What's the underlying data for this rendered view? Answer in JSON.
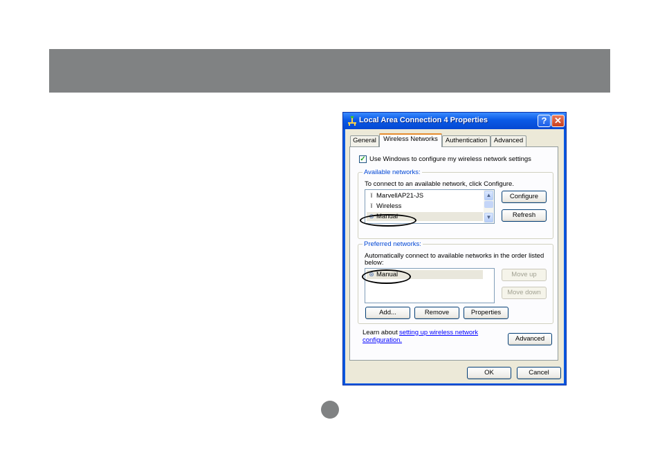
{
  "dialog": {
    "title": "Local Area Connection 4 Properties",
    "help_label": "?",
    "close_label": "✕",
    "tabs": [
      "General",
      "Wireless Networks",
      "Authentication",
      "Advanced"
    ],
    "use_windows_checkbox": {
      "checked": true,
      "label": "Use Windows to configure my wireless network settings"
    },
    "available": {
      "group_title": "Available networks:",
      "instruction": "To connect to an available network, click Configure.",
      "networks": [
        {
          "name": "MarvellAP21-JS",
          "icon": "antenna-icon"
        },
        {
          "name": "Wireless",
          "icon": "antenna-icon"
        },
        {
          "name": "Manual",
          "icon": "wireless-network-icon"
        }
      ],
      "configure_label": "Configure",
      "refresh_label": "Refresh"
    },
    "preferred": {
      "group_title": "Preferred networks:",
      "instruction_line1": "Automatically connect to available networks in the order listed",
      "instruction_line2": "below:",
      "networks": [
        {
          "name": "Manual",
          "icon": "wireless-network-icon"
        }
      ],
      "move_up_label": "Move up",
      "move_down_label": "Move down",
      "add_label": "Add...",
      "remove_label": "Remove",
      "properties_label": "Properties"
    },
    "learn_prefix": "Learn about ",
    "learn_link_part1": "setting up wireless network",
    "learn_link_part2": "configuration.",
    "advanced_label": "Advanced",
    "ok_label": "OK",
    "cancel_label": "Cancel"
  },
  "colors": {
    "title_bar": "#0b5ae6",
    "header_band": "#808283",
    "link": "#0000ff",
    "group_title": "#0046d5"
  }
}
